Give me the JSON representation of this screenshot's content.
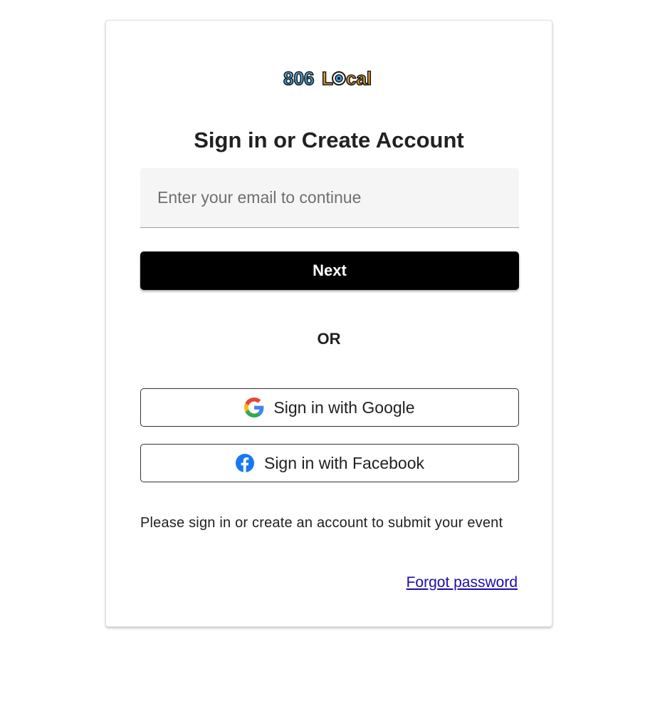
{
  "logo": {
    "text": "806Local",
    "colors": {
      "digits": "#3aa9e8",
      "letters": "#e8a22a",
      "outline": "#1a1a1a"
    }
  },
  "title": "Sign in or Create Account",
  "email": {
    "placeholder": "Enter your email to continue",
    "value": ""
  },
  "next_label": "Next",
  "or_label": "OR",
  "google": {
    "label": "Sign in with Google",
    "icon": "google-g-icon"
  },
  "facebook": {
    "label": "Sign in with Facebook",
    "icon": "facebook-icon",
    "color": "#1877f2"
  },
  "note": "Please sign in or create an account to submit your event",
  "forgot_label": "Forgot password",
  "colors": {
    "primary_button": "#000000",
    "link": "#1a0dab",
    "field_background": "#f5f5f5"
  }
}
